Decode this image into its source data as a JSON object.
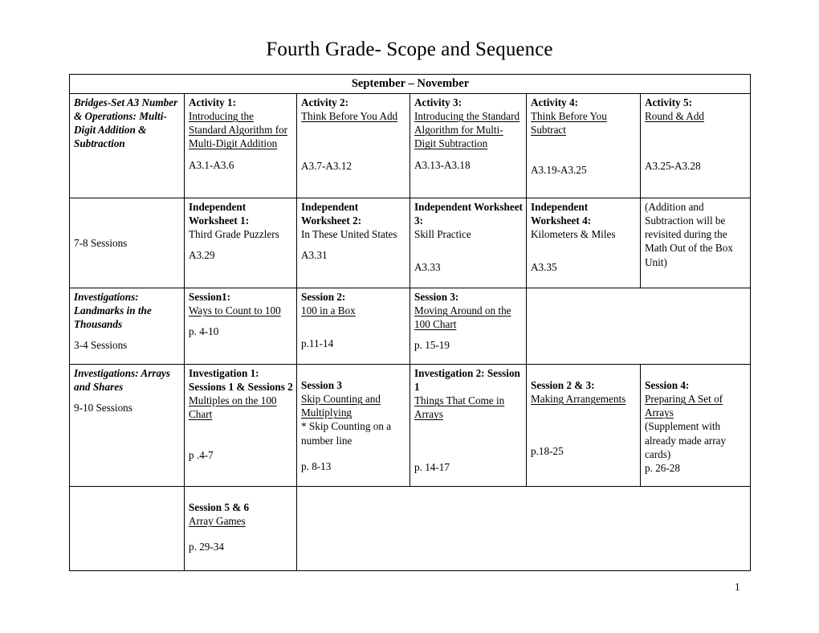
{
  "document": {
    "title": "Fourth Grade- Scope and Sequence",
    "page_number": "1"
  },
  "table": {
    "month_header": "September – November",
    "rows": [
      {
        "name": "bridges-set-a3-activities",
        "cells": [
          {
            "unit": "Bridges-Set A3 Number & Operations: Multi-Digit Addition & Subtraction",
            "sessions": "7-8 Sessions"
          },
          {
            "heading": "Activity 1:",
            "link": "Introducing the Standard Algorithm for Multi-Digit Addition",
            "pages": "A3.1-A3.6"
          },
          {
            "heading": "Activity 2:",
            "link": "Think Before You Add",
            "pages": "A3.7-A3.12"
          },
          {
            "heading": "Activity 3:",
            "link": "Introducing the Standard Algorithm for Multi-Digit Subtraction",
            "pages": "A3.13-A3.18"
          },
          {
            "heading": "Activity 4:",
            "link": "Think Before You Subtract",
            "pages": "A3.19-A3.25"
          },
          {
            "heading": "Activity 5:",
            "link": "Round & Add",
            "pages": "A3.25-A3.28"
          }
        ]
      },
      {
        "name": "bridges-set-a3-worksheets",
        "cells": [
          {
            "heading": "Independent Worksheet 1:",
            "text": "Third Grade Puzzlers",
            "pages": "A3.29"
          },
          {
            "heading": "Independent Worksheet 2:",
            "text": "In These United States",
            "pages": "A3.31"
          },
          {
            "heading": "Independent Worksheet 3:",
            "text": "Skill Practice",
            "pages": "A3.33"
          },
          {
            "heading": "Independent Worksheet 4:",
            "text": "Kilometers & Miles",
            "pages": "A3.35"
          },
          {
            "note": "(Addition and Subtraction will be revisited during the Math Out of the Box Unit)"
          }
        ]
      },
      {
        "name": "investigations-landmarks",
        "cells": [
          {
            "unit": "Investigations: Landmarks in the Thousands",
            "sessions": "3-4 Sessions"
          },
          {
            "heading": "Session1:",
            "link": "Ways to Count to 100",
            "pages": "p. 4-10"
          },
          {
            "heading": "Session 2:",
            "link": "100 in a Box",
            "pages": "p.11-14"
          },
          {
            "heading": "Session 3:",
            "link": "Moving Around on the 100 Chart",
            "pages": "p. 15-19"
          },
          {
            "empty": ""
          }
        ]
      },
      {
        "name": "investigations-arrays-and-shares",
        "cells": [
          {
            "unit": "Investigations: Arrays and Shares",
            "sessions": "9-10 Sessions"
          },
          {
            "heading": "Investigation 1: Sessions 1 & Sessions 2",
            "link": "Multiples on the 100 Chart",
            "pages": "p .4-7"
          },
          {
            "heading": "Session 3",
            "link": "Skip Counting and Multiplying",
            "text": "* Skip Counting on a number line",
            "pages": "p. 8-13"
          },
          {
            "heading": "Investigation 2: Session 1",
            "link": "Things That Come in Arrays",
            "pages": "p. 14-17"
          },
          {
            "heading": "Session 2 & 3:",
            "link": "Making Arrangements",
            "pages": "p.18-25"
          },
          {
            "heading": "Session 4:",
            "link": "Preparing A Set of Arrays",
            "text": "(Supplement with already made array cards)",
            "pages": "p. 26-28"
          }
        ]
      },
      {
        "name": "array-games-row",
        "cells": [
          {
            "empty": ""
          },
          {
            "heading": "Session 5 & 6",
            "link": "Array Games",
            "pages": "p. 29-34"
          },
          {
            "empty": ""
          }
        ]
      }
    ]
  }
}
